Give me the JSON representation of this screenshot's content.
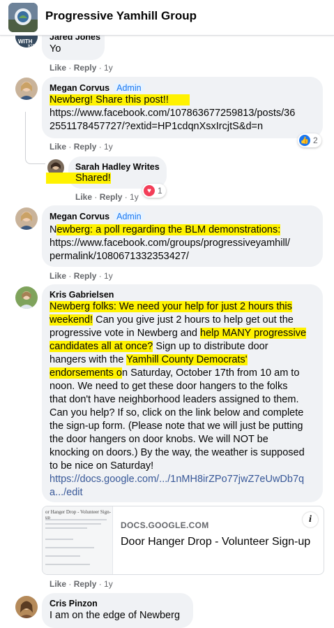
{
  "header": {
    "title": "Progressive Yamhill Group"
  },
  "comments": [
    {
      "author": "Jared Jones",
      "lines": [
        [
          "Yo"
        ]
      ],
      "like": "Like",
      "reply": "Reply",
      "time": "1y"
    },
    {
      "author": "Megan Corvus",
      "badge": "Admin",
      "text_line1": "Newberg! Share this post!!",
      "link_line1": "https://www.facebook.com/107863677259813/posts/36",
      "link_line2": "2551178457727/?extid=HP1cdqnXsxIrcjtS&d=n",
      "like": "Like",
      "reply": "Reply",
      "time": "1y",
      "reaction": {
        "type": "like-icon",
        "count": "2",
        "color": "#1877f2"
      }
    },
    {
      "author": "Sarah Hadley Writes",
      "text": "Shared!",
      "like": "Like",
      "reply": "Reply",
      "time": "1y",
      "reaction": {
        "type": "heart-icon",
        "count": "1",
        "color": "#f33e58"
      }
    },
    {
      "author": "Megan Corvus",
      "badge": "Admin",
      "text_line1_a": "N",
      "text_line1_b": "ewberg: a poll regarding the BLM demonstrations:",
      "link_line1": "https://www.facebook.com/groups/progressiveyamhill/",
      "link_line2": "permalink/1080671332353427/",
      "like": "Like",
      "reply": "Reply",
      "time": "1y"
    },
    {
      "author": "Kris Gabrielsen",
      "l1": "Newberg folks: We need your help for just 2 hours this",
      "l2a": "weekend!",
      "l2b": " Can you give just 2 hours to help get out the",
      "l3a": "progressive vote in Newberg and ",
      "l3b": "help MANY progressive",
      "l4a": "candidates all at once?",
      "l4b": " Sign up to distribute door",
      "l5a": "hangers with the ",
      "l5b": "Yamhill County Democrats'",
      "l6a": "endorsements o",
      "l6b": "n Saturday, October 17th from 10 am to",
      "l7": "noon. We need to get these door hangers to the folks",
      "l8": "that don't have neighborhood leaders assigned to them.",
      "l9": "Can you help? If so, click on the link below and complete",
      "l10": "the sign-up form. (Please note that we will just be putting",
      "l11": "the door hangers on door knobs. We will NOT be",
      "l12": "knocking on doors.) By the way, the weather is supposed",
      "l13": "to be nice on Saturday!",
      "link1": "https://docs.google.com/.../1nMH8irZPo77jwZ7eUwDb7q",
      "link2": "a.../edit",
      "preview": {
        "domain": "DOCS.GOOGLE.COM",
        "title": "Door Hanger Drop - Volunteer Sign-up",
        "thumb_title": "or Hanger Drop - Volunteer Sign-up"
      },
      "like": "Like",
      "reply": "Reply",
      "time": "1y"
    },
    {
      "author": "Cris Pinzon",
      "text": "I am on the edge of Newberg"
    }
  ],
  "colors": {
    "highlight": "#fff200",
    "link": "#385898",
    "admin": "#1877f2",
    "bubble": "#f0f2f5"
  }
}
